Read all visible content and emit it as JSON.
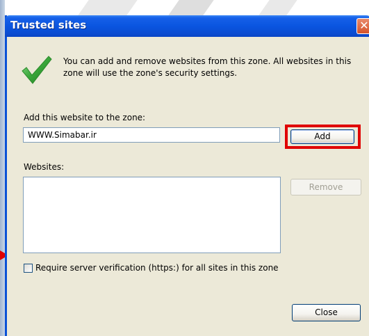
{
  "dialog": {
    "title": "Trusted sites",
    "close_glyph": "✕",
    "info_text": "You can add and remove websites from this zone. All websites in this zone will use the zone's security settings.",
    "add_label": "Add this website to the zone:",
    "site_input_value": "WWW.Simabar.ir",
    "add_button": "Add",
    "websites_label": "Websites:",
    "remove_button": "Remove",
    "https_checkbox_label": "Require server verification (https:) for all sites in this zone",
    "https_checked": false,
    "close_button": "Close"
  },
  "icons": {
    "title_close": "close-icon",
    "info": "green-checkmark-icon",
    "annotation_arrow": "red-arrow-icon"
  },
  "colors": {
    "titlebar_blue": "#0a55e0",
    "dialog_face": "#ece9d8",
    "highlight_red": "#e00000",
    "checkmark_green": "#3aa63a"
  }
}
